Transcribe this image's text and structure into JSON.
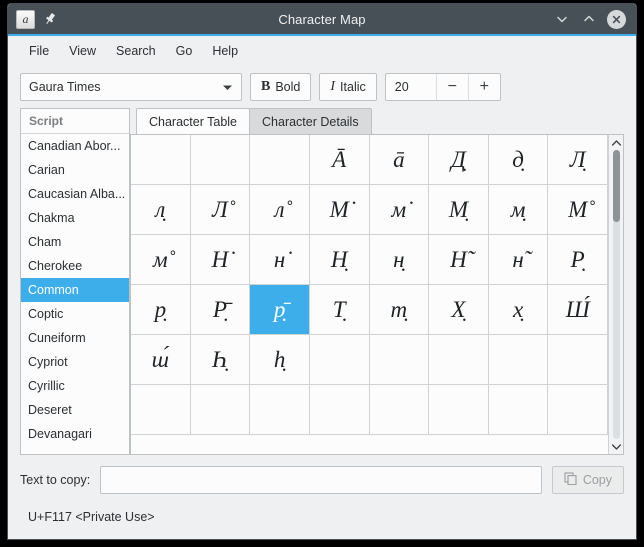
{
  "window": {
    "title": "Character Map",
    "app_icon": "character-map-icon",
    "pin_icon": "pin-icon",
    "controls": {
      "minimize": "chevron-down-icon",
      "maximize": "chevron-up-icon",
      "close": "close-icon"
    },
    "accent_color": "#3daee9",
    "titlebar_color": "#475057"
  },
  "menubar": {
    "items": [
      {
        "label": "File"
      },
      {
        "label": "View"
      },
      {
        "label": "Search"
      },
      {
        "label": "Go"
      },
      {
        "label": "Help"
      }
    ]
  },
  "toolbar": {
    "font_family": "Gaura Times",
    "bold_label": "Bold",
    "bold_glyph": "B",
    "italic_label": "Italic",
    "italic_glyph": "I",
    "font_size": "20",
    "decrease_label": "−",
    "increase_label": "+"
  },
  "sidebar": {
    "header": "Script",
    "items": [
      {
        "label": "Canadian Abor...",
        "selected": false
      },
      {
        "label": "Carian",
        "selected": false
      },
      {
        "label": "Caucasian Alba...",
        "selected": false
      },
      {
        "label": "Chakma",
        "selected": false
      },
      {
        "label": "Cham",
        "selected": false
      },
      {
        "label": "Cherokee",
        "selected": false
      },
      {
        "label": "Common",
        "selected": true
      },
      {
        "label": "Coptic",
        "selected": false
      },
      {
        "label": "Cuneiform",
        "selected": false
      },
      {
        "label": "Cypriot",
        "selected": false
      },
      {
        "label": "Cyrillic",
        "selected": false
      },
      {
        "label": "Deseret",
        "selected": false
      },
      {
        "label": "Devanagari",
        "selected": false
      }
    ]
  },
  "tabs": [
    {
      "label": "Character Table",
      "active": true
    },
    {
      "label": "Character Details",
      "active": false
    }
  ],
  "character_grid": {
    "columns": 8,
    "rows": 6,
    "cells": [
      {
        "glyph": "",
        "selected": false
      },
      {
        "glyph": "",
        "selected": false
      },
      {
        "glyph": "",
        "selected": false
      },
      {
        "glyph": "Ā",
        "selected": false
      },
      {
        "glyph": "ā",
        "selected": false
      },
      {
        "glyph": "Д̣",
        "selected": false
      },
      {
        "glyph": "д̣",
        "selected": false
      },
      {
        "glyph": "Л̣",
        "selected": false
      },
      {
        "glyph": "л̣",
        "selected": false
      },
      {
        "glyph": "Л̊",
        "selected": false
      },
      {
        "glyph": "л̊",
        "selected": false
      },
      {
        "glyph": "М̇",
        "selected": false
      },
      {
        "glyph": "м̇",
        "selected": false
      },
      {
        "glyph": "М̣",
        "selected": false
      },
      {
        "glyph": "м̣",
        "selected": false
      },
      {
        "glyph": "М̊",
        "selected": false
      },
      {
        "glyph": "м̊",
        "selected": false
      },
      {
        "glyph": "Н̇",
        "selected": false
      },
      {
        "glyph": "н̇",
        "selected": false
      },
      {
        "glyph": "Н̣",
        "selected": false
      },
      {
        "glyph": "н̣",
        "selected": false
      },
      {
        "glyph": "Н̃",
        "selected": false
      },
      {
        "glyph": "н̃",
        "selected": false
      },
      {
        "glyph": "Р̣",
        "selected": false
      },
      {
        "glyph": "р̣",
        "selected": false
      },
      {
        "glyph": "Р̣̄",
        "selected": false
      },
      {
        "glyph": "р̣̄",
        "selected": true
      },
      {
        "glyph": "Т̣",
        "selected": false
      },
      {
        "glyph": "т̣",
        "selected": false
      },
      {
        "glyph": "Х̣",
        "selected": false
      },
      {
        "glyph": "х̣",
        "selected": false
      },
      {
        "glyph": "Ш́",
        "selected": false
      },
      {
        "glyph": "ш́",
        "selected": false
      },
      {
        "glyph": "Һ̣",
        "selected": false
      },
      {
        "glyph": "һ̣",
        "selected": false
      },
      {
        "glyph": "",
        "selected": false
      },
      {
        "glyph": "",
        "selected": false
      },
      {
        "glyph": "",
        "selected": false
      },
      {
        "glyph": "",
        "selected": false
      },
      {
        "glyph": "",
        "selected": false
      },
      {
        "glyph": "",
        "selected": false
      },
      {
        "glyph": "",
        "selected": false
      },
      {
        "glyph": "",
        "selected": false
      },
      {
        "glyph": "",
        "selected": false
      },
      {
        "glyph": "",
        "selected": false
      },
      {
        "glyph": "",
        "selected": false
      },
      {
        "glyph": "",
        "selected": false
      },
      {
        "glyph": "",
        "selected": false
      }
    ]
  },
  "bottom": {
    "copy_label": "Text to copy:",
    "copy_value": "",
    "copy_button": "Copy",
    "copy_button_icon": "copy-icon",
    "copy_button_disabled": true
  },
  "statusbar": {
    "text": "U+F117 <Private Use>"
  }
}
